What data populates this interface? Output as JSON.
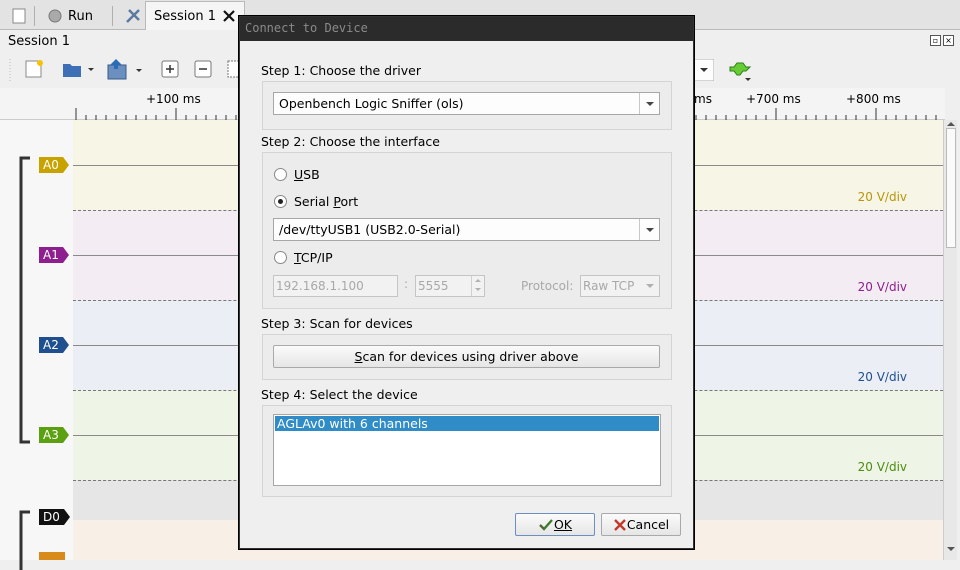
{
  "tabs": {
    "run_label": "Run",
    "session_label": "Session 1"
  },
  "session_title": "Session 1",
  "ruler": {
    "labels_left": [
      "+100 ms"
    ],
    "labels_right": [
      "ms",
      "+700 ms",
      "+800 ms"
    ]
  },
  "channels": [
    {
      "name": "A0",
      "color": "#c8a300",
      "scale": "20 V/div",
      "scale_color": "#b8960a"
    },
    {
      "name": "A1",
      "color": "#8e1f8e",
      "scale": "20 V/div",
      "scale_color": "#8e1f8e"
    },
    {
      "name": "A2",
      "color": "#1f4f8e",
      "scale": "20 V/div",
      "scale_color": "#1f4f8e"
    },
    {
      "name": "A3",
      "color": "#5aa010",
      "scale": "20 V/div",
      "scale_color": "#4d8c10"
    },
    {
      "name": "D0",
      "color": "#111111"
    }
  ],
  "dialog": {
    "title": "Connect to Device",
    "step1_label": "Step 1: Choose the driver",
    "driver_value": "Openbench Logic Sniffer (ols)",
    "step2_label": "Step 2: Choose the interface",
    "usb_label": "USB",
    "usb_mnemonic": "U",
    "usb_rest": "SB",
    "serial_label_pre": "Serial ",
    "serial_mnemonic": "P",
    "serial_label_post": "ort",
    "serial_port_value": "/dev/ttyUSB1 (USB2.0-Serial)",
    "tcp_mnemonic": "T",
    "tcp_rest": "CP/IP",
    "ip_value": "192.168.1.100",
    "colon": ":",
    "port_value": "5555",
    "protocol_label": "Protocol:",
    "protocol_value": "Raw TCP",
    "step3_label": "Step 3: Scan for devices",
    "scan_mnemonic": "S",
    "scan_rest": "can for devices using driver above",
    "step4_label": "Step 4: Select the device",
    "device_item": "AGLAv0 with 6 channels",
    "ok_label": "OK",
    "cancel_label": "Cancel",
    "selected_interface": "Serial Port"
  }
}
